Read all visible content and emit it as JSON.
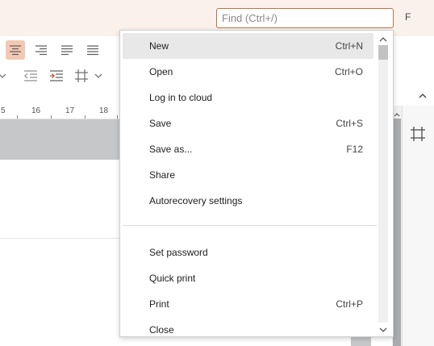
{
  "search": {
    "placeholder": "Find (Ctrl+/)"
  },
  "user": {
    "initial": "F"
  },
  "ruler": {
    "labels": [
      "5",
      "16",
      "17",
      "18"
    ]
  },
  "icons": {
    "align_center": "align-center-icon",
    "align_right": "align-right-icon",
    "justify": "justify-icon",
    "distributed": "distributed-icon",
    "decrease_indent": "decrease-indent-icon",
    "increase_indent": "increase-indent-icon",
    "crop": "crop-icon",
    "chevron": "chevron-down-icon",
    "collapse": "chevron-up-icon"
  },
  "menu": {
    "items": [
      {
        "label": "New",
        "shortcut": "Ctrl+N"
      },
      {
        "label": "Open",
        "shortcut": "Ctrl+O"
      },
      {
        "label": "Log in to cloud",
        "shortcut": ""
      },
      {
        "label": "Save",
        "shortcut": "Ctrl+S"
      },
      {
        "label": "Save as...",
        "shortcut": "F12"
      },
      {
        "label": "Share",
        "shortcut": ""
      },
      {
        "label": "Autorecovery settings",
        "shortcut": ""
      },
      {
        "label": "Set password",
        "shortcut": ""
      },
      {
        "label": "Quick print",
        "shortcut": ""
      },
      {
        "label": "Print",
        "shortcut": "Ctrl+P"
      },
      {
        "label": "Close",
        "shortcut": ""
      }
    ]
  },
  "colors": {
    "accent": "#c4723d",
    "titlebar": "#fbf1eb",
    "active_button": "#f3c9b3"
  }
}
